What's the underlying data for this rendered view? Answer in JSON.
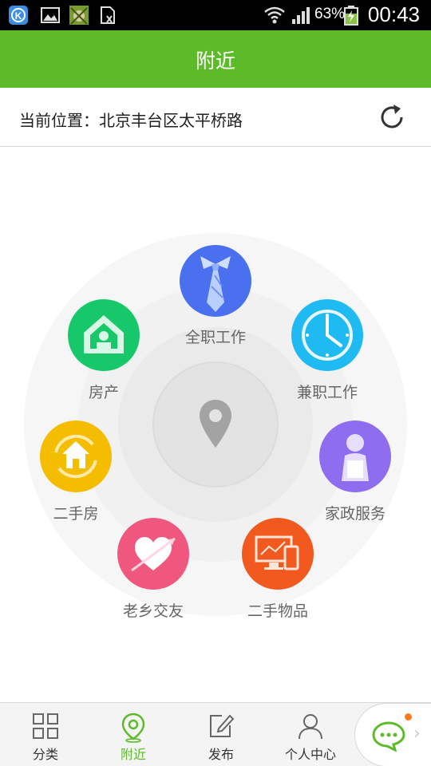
{
  "status_bar": {
    "battery": "63%",
    "time": "00:43",
    "icons": [
      "k-app-icon",
      "image-icon",
      "game-icon",
      "sim-icon",
      "wifi-icon",
      "signal-icon",
      "battery-icon"
    ]
  },
  "header": {
    "title": "附近"
  },
  "location": {
    "text": "当前位置：北京丰台区太平桥路",
    "refresh_icon": "refresh-icon"
  },
  "wheel": {
    "center_icon": "location-pin-icon",
    "categories": [
      {
        "label": "全职工作",
        "icon": "necktie-icon",
        "color": "#4a70f0"
      },
      {
        "label": "兼职工作",
        "icon": "clock-icon",
        "color": "#1fbaf2"
      },
      {
        "label": "家政服务",
        "icon": "housekeeper-icon",
        "color": "#8f6df0"
      },
      {
        "label": "二手物品",
        "icon": "computer-phone-icon",
        "color": "#f2591f"
      },
      {
        "label": "老乡交友",
        "icon": "heart-arrow-icon",
        "color": "#f0577e"
      },
      {
        "label": "二手房",
        "icon": "house-cycle-icon",
        "color": "#f4bd00"
      },
      {
        "label": "房产",
        "icon": "house-icon",
        "color": "#17c86a"
      }
    ]
  },
  "bottom_nav": {
    "active_color": "#5dbb2a",
    "items": [
      {
        "label": "分类",
        "icon": "grid-icon",
        "active": false
      },
      {
        "label": "附近",
        "icon": "location-pin-icon",
        "active": true
      },
      {
        "label": "发布",
        "icon": "edit-icon",
        "active": false
      },
      {
        "label": "个人中心",
        "icon": "person-icon",
        "active": false
      }
    ],
    "chat_icon": "chat-bubble-icon"
  }
}
